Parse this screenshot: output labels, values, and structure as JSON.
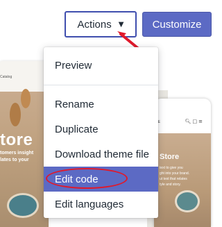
{
  "toolbar": {
    "actions_label": "Actions",
    "actions_caret_icon": "caret-down-icon",
    "customize_label": "Customize"
  },
  "menu": {
    "items": [
      {
        "label": "Preview"
      },
      {
        "label": "Rename"
      },
      {
        "label": "Duplicate"
      },
      {
        "label": "Download theme file"
      },
      {
        "label": "Edit code",
        "highlighted": true
      },
      {
        "label": "Edit languages"
      }
    ]
  },
  "preview_left": {
    "nav_text": "Catalog",
    "hero_title": "tore",
    "hero_sub_line1": "tomers insight",
    "hero_sub_line2": "lates to your"
  },
  "preview_phone": {
    "logo_text": "DE",
    "hero_title": "Store",
    "hero_sub_line1": "text to give you",
    "hero_sub_line2": "ght into your brand.",
    "hero_sub_line3": "ut text that relates",
    "hero_sub_line4": "tyle and story."
  },
  "annotations": {
    "arrow_color": "#e0192b",
    "circle_color": "#e0192b"
  },
  "colors": {
    "accent": "#5c6ac4",
    "focus_border": "#3f4eae",
    "text": "#212b36"
  }
}
